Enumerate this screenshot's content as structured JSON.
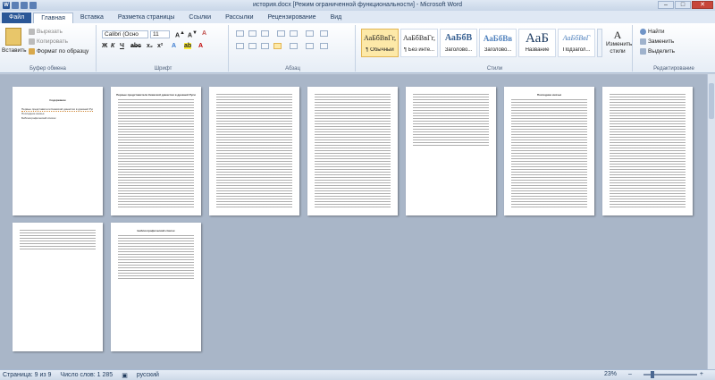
{
  "window": {
    "title": "история.docx [Режим ограниченной функциональности] - Microsoft Word",
    "app_icon": "W"
  },
  "tabs": [
    "Файл",
    "Главная",
    "Вставка",
    "Разметка страницы",
    "Ссылки",
    "Рассылки",
    "Рецензирование",
    "Вид"
  ],
  "ribbon": {
    "clipboard": {
      "paste": "Вставить",
      "cut": "Вырезать",
      "copy": "Копировать",
      "format_painter": "Формат по образцу",
      "label": "Буфер обмена"
    },
    "font": {
      "name": "Calibri (Осно",
      "size": "11",
      "label": "Шрифт"
    },
    "paragraph": {
      "label": "Абзац"
    },
    "styles": {
      "items": [
        {
          "sample": "АаБбВвГг,",
          "name": "¶ Обычный"
        },
        {
          "sample": "АаБбВвГг,",
          "name": "¶ Без инте..."
        },
        {
          "sample": "АаБбВ",
          "name": "Заголово..."
        },
        {
          "sample": "АаБбВв",
          "name": "Заголово..."
        },
        {
          "sample": "АаБ",
          "name": "Название"
        },
        {
          "sample": "АаБбВвГ",
          "name": "Подзагол..."
        }
      ],
      "change": "Изменить стили",
      "label": "Стили"
    },
    "editing": {
      "find": "Найти",
      "replace": "Заменить",
      "select": "Выделить",
      "label": "Редактирование"
    }
  },
  "pages": {
    "p1_title": "Содержание",
    "p1_items": [
      "Первые представители Киевской династии в древней Руси",
      "Последние князья",
      "Библиографический список"
    ],
    "p2_heading": "Первые представители Киевской династии в древней Руси",
    "p6_heading": "Последние князья",
    "p10_heading": "Библиографический список"
  },
  "status": {
    "page": "Страница: 9 из 9",
    "words": "Число слов: 1 285",
    "language": "русский",
    "zoom": "23%"
  },
  "colors": {
    "ribbon_accent": "#2b5797",
    "workspace": "#a9b6c8"
  }
}
